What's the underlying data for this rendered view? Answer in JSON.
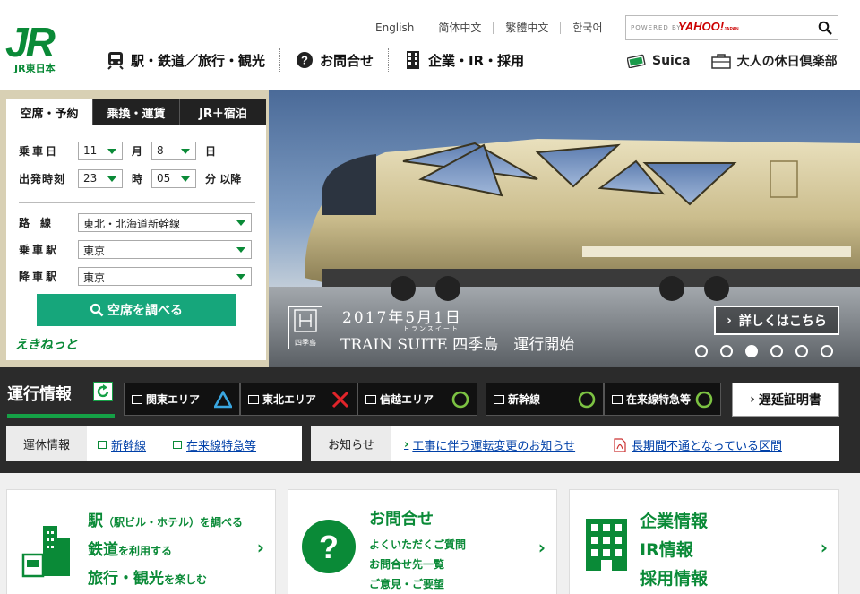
{
  "header": {
    "logo_mark": "JR",
    "logo_text": "JR東日本",
    "languages": [
      "English",
      "简体中文",
      "繁體中文",
      "한국어"
    ],
    "search": {
      "powered_by": "POWERED BY",
      "provider": "YAHOO!",
      "provider_sub": "JAPAN"
    },
    "nav": [
      {
        "label": "駅・鉄道／旅行・観光",
        "icon": "train-icon"
      },
      {
        "label": "お問合せ",
        "icon": "question-icon"
      },
      {
        "label": "企業・IR・採用",
        "icon": "building-icon"
      }
    ],
    "subnav": [
      {
        "label": "Suica",
        "icon": "suica-card-icon"
      },
      {
        "label": "大人の休日倶楽部",
        "icon": "briefcase-icon"
      }
    ]
  },
  "booking": {
    "tabs": [
      "空席・予約",
      "乗換・運賃",
      "JR＋宿泊"
    ],
    "date_label": "乗車日",
    "month_value": "11",
    "month_unit": "月",
    "day_value": "8",
    "day_unit": "日",
    "time_label": "出発時刻",
    "hour_value": "23",
    "hour_unit": "時",
    "minute_value": "05",
    "minute_unit": "分 以降",
    "line_label": "路　線",
    "line_value": "東北・北海道新幹線",
    "from_label": "乗車駅",
    "from_value": "東京",
    "to_label": "降車駅",
    "to_value": "東京",
    "search_button": "空席を調べる",
    "brand": "えきねっと"
  },
  "hero": {
    "date": "2017年5月1日",
    "ruby": "トランスイート",
    "title": "TRAIN SUITE 四季島　運行開始",
    "logo_text": "四季島",
    "detail_button": "詳しくはこちら",
    "slides": 6,
    "active_slide": 3
  },
  "status": {
    "title": "運行情報",
    "areas": [
      {
        "label": "関東エリア",
        "state": "delay-triangle"
      },
      {
        "label": "東北エリア",
        "state": "suspended-cross"
      },
      {
        "label": "信越エリア",
        "state": "normal-circle"
      },
      {
        "label": "新幹線",
        "state": "normal-circle"
      },
      {
        "label": "在来線特急等",
        "state": "normal-circle"
      }
    ],
    "delay_cert": "遅延証明書",
    "suspension_label": "運休情報",
    "suspension_links": [
      "新幹線",
      "在来線特急等"
    ],
    "notice_label": "お知らせ",
    "notices": [
      "工事に伴う運転変更のお知らせ",
      "長期間不通となっている区間"
    ]
  },
  "cards": {
    "card1": {
      "lines": [
        {
          "main": "駅",
          "sub": "（駅ビル・ホテル）を調べる"
        },
        {
          "main": "鉄道",
          "sub": "を利用する"
        },
        {
          "main": "旅行・観光",
          "sub": "を楽しむ"
        }
      ]
    },
    "card2": {
      "title": "お問合せ",
      "items": [
        "よくいただくご質問",
        "お問合せ先一覧",
        "ご意見・ご要望"
      ]
    },
    "card3": {
      "items": [
        "企業情報",
        "IR情報",
        "採用情報"
      ]
    }
  },
  "colors": {
    "brand_green": "#0a8a37",
    "button_teal": "#16a67b"
  }
}
